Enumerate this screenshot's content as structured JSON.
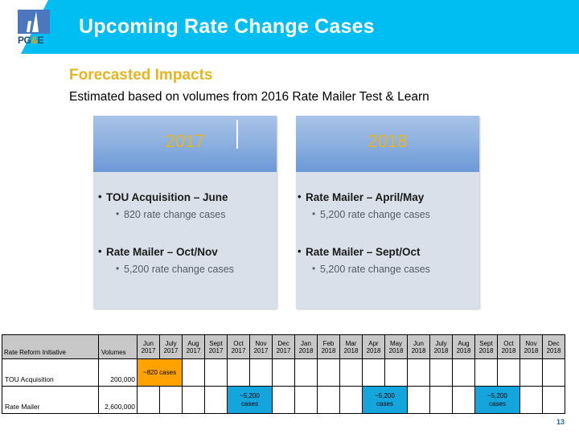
{
  "header": {
    "title": "Upcoming Rate Change Cases",
    "banner_color": "#00bdf2",
    "logo": {
      "name": "pge-logo",
      "text_pg": "PG",
      "text_amp": "&",
      "text_e": "E",
      "trademark": "®"
    }
  },
  "subhead": {
    "heading": "Forecasted Impacts",
    "heading_color": "#e8b420",
    "note": "Estimated based on volumes from 2016 Rate Mailer Test & Learn"
  },
  "panels": [
    {
      "year": "2017",
      "items": [
        {
          "main": "TOU Acquisition – June",
          "sub": "820 rate change cases"
        },
        {
          "main": "Rate Mailer – Oct/Nov",
          "sub": "5,200 rate change cases"
        }
      ]
    },
    {
      "year": "2018",
      "items": [
        {
          "main": "Rate Mailer – April/May",
          "sub": "5,200 rate change cases"
        },
        {
          "main": "Rate Mailer – Sept/Oct",
          "sub": "5,200 rate change cases"
        }
      ]
    }
  ],
  "table": {
    "headers": {
      "initiative": "Rate Reform Initiative",
      "volumes": "Volumes"
    },
    "months": [
      {
        "name": "Jun",
        "year": "2017"
      },
      {
        "name": "July",
        "year": "2017"
      },
      {
        "name": "Aug",
        "year": "2017"
      },
      {
        "name": "Sept",
        "year": "2017"
      },
      {
        "name": "Oct",
        "year": "2017"
      },
      {
        "name": "Nov",
        "year": "2017"
      },
      {
        "name": "Dec",
        "year": "2017"
      },
      {
        "name": "Jan",
        "year": "2018"
      },
      {
        "name": "Feb",
        "year": "2018"
      },
      {
        "name": "Mar",
        "year": "2018"
      },
      {
        "name": "Apr",
        "year": "2018"
      },
      {
        "name": "May",
        "year": "2018"
      },
      {
        "name": "Jun",
        "year": "2018"
      },
      {
        "name": "July",
        "year": "2018"
      },
      {
        "name": "Aug",
        "year": "2018"
      },
      {
        "name": "Sept",
        "year": "2018"
      },
      {
        "name": "Oct",
        "year": "2018"
      },
      {
        "name": "Nov",
        "year": "2018"
      },
      {
        "name": "Dec",
        "year": "2018"
      }
    ],
    "rows": [
      {
        "label": "TOU Acquisition",
        "volume": "200,000",
        "bars": [
          {
            "start_month": "Jun 2017",
            "span": 2,
            "label": "~820 cases",
            "color": "#ffa200"
          }
        ]
      },
      {
        "label": "Rate Mailer",
        "volume": "2,600,000",
        "bars": [
          {
            "start_month": "Oct 2017",
            "span": 2,
            "label_line1": "~5,200",
            "label_line2": "cases",
            "color": "#14a5dc"
          },
          {
            "start_month": "Apr 2018",
            "span": 2,
            "label_line1": "~5,200",
            "label_line2": "cases",
            "color": "#14a5dc"
          },
          {
            "start_month": "Sept 2018",
            "span": 2,
            "label_line1": "~5,200",
            "label_line2": "cases",
            "color": "#14a5dc"
          }
        ]
      }
    ]
  },
  "footer": {
    "page_number": "13"
  }
}
